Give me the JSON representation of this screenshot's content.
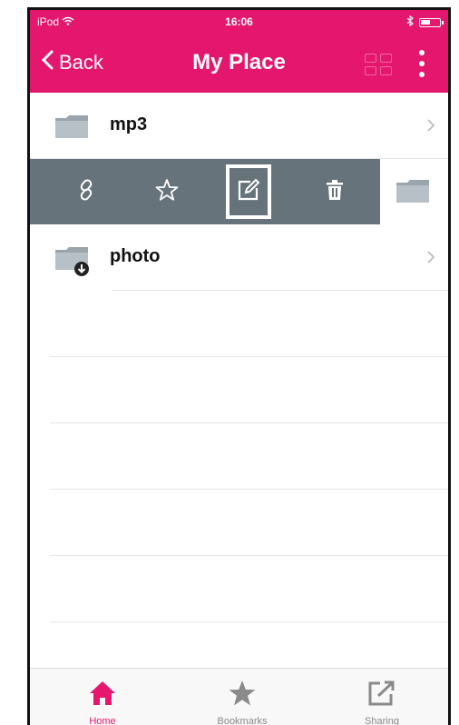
{
  "status": {
    "carrier": "iPod",
    "time": "16:06"
  },
  "header": {
    "back_label": "Back",
    "title": "My Place"
  },
  "folders": [
    {
      "name": "mp3"
    },
    {
      "name": "photo"
    }
  ],
  "tabs": [
    {
      "label": "Home"
    },
    {
      "label": "Bookmarks"
    },
    {
      "label": "Sharing"
    }
  ],
  "colors": {
    "accent": "#e5166e",
    "action_bar": "#67737a",
    "folder": "#9aa4ac"
  }
}
